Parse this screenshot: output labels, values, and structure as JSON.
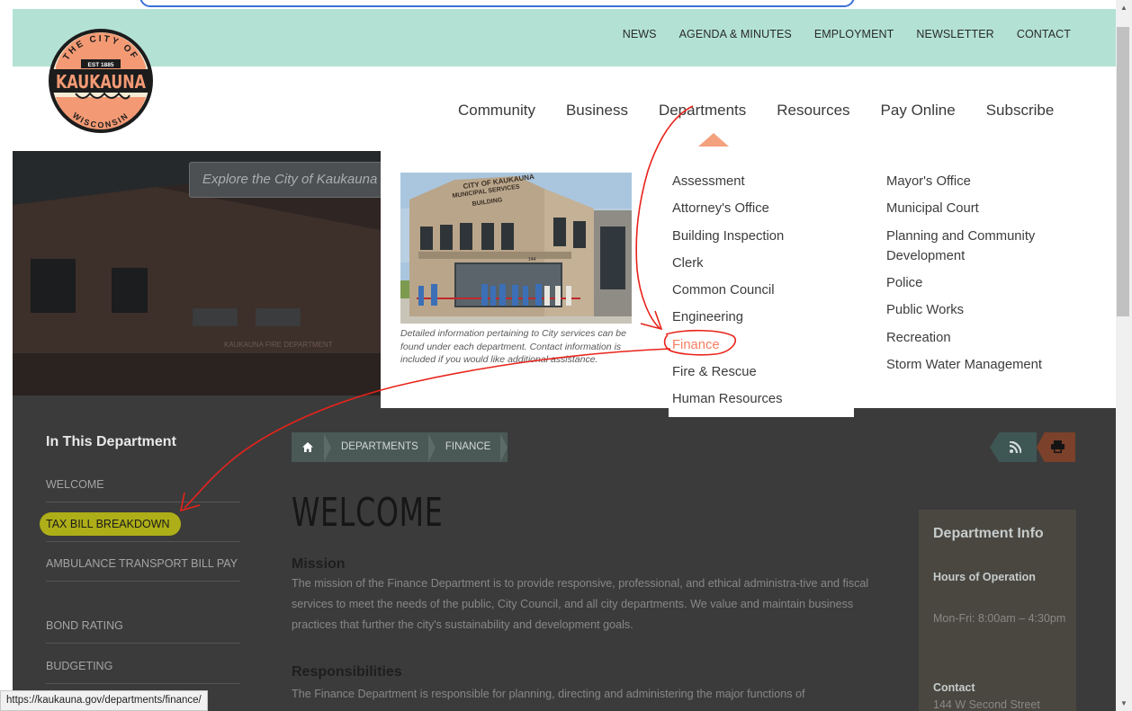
{
  "utility_nav": [
    "NEWS",
    "AGENDA & MINUTES",
    "EMPLOYMENT",
    "NEWSLETTER",
    "CONTACT"
  ],
  "logo": {
    "top": "THE CITY OF",
    "est": "EST 1885",
    "name": "KAUKAUNA",
    "bottom": "WISCONSIN"
  },
  "main_nav": [
    "Community",
    "Business",
    "Departments",
    "Resources",
    "Pay Online",
    "Subscribe"
  ],
  "hero": {
    "search_placeholder": "Explore the City of Kaukauna",
    "building_sign": "KAUKAUNA FIRE DEPARTMENT"
  },
  "dropdown": {
    "photo_sign": "CITY OF KAUKAUNA MUNICIPAL SERVICES BUILDING",
    "caption": "Detailed information pertaining to City services can be found under each department. Contact information is included if you would like additional assistance.",
    "col1": [
      "Assessment",
      "Attorney's Office",
      "Building Inspection",
      "Clerk",
      "Common Council",
      "Engineering",
      "Finance",
      "Fire & Rescue",
      "Human Resources"
    ],
    "col2": [
      "Mayor's Office",
      "Municipal Court",
      "Planning and Community Development",
      "Police",
      "Public Works",
      "Recreation",
      "Storm Water Management"
    ]
  },
  "sidebar": {
    "title": "In This Department",
    "items": [
      "WELCOME",
      "TAX BILL BREAKDOWN",
      "AMBULANCE TRANSPORT BILL PAY",
      "BOND RATING",
      "BUDGETING"
    ]
  },
  "breadcrumb": [
    "DEPARTMENTS",
    "FINANCE"
  ],
  "content": {
    "title": "WELCOME",
    "mission_head": "Mission",
    "mission_text": "The mission of the Finance Department is to provide responsive, professional, and ethical administra-tive and fiscal services to meet the needs of the public, City Council, and all city departments. We value and maintain business practices that further the city's sustainability and development goals.",
    "resp_head": "Responsibilities",
    "resp_text": "The Finance Department is responsible for planning, directing and administering the major functions of"
  },
  "dept_info": {
    "title": "Department Info",
    "hours_head": "Hours of Operation",
    "hours": "Mon-Fri: 8:00am – 4:30pm",
    "contact_head": "Contact",
    "address": "144 W Second Street"
  },
  "status_url": "https://kaukauna.gov/departments/finance/",
  "colors": {
    "teal": "#b3e2d5",
    "accent": "#f47f62",
    "overlay": "#3b3b3b",
    "highlight": "#b9b816",
    "annotation": "#e8231b"
  }
}
